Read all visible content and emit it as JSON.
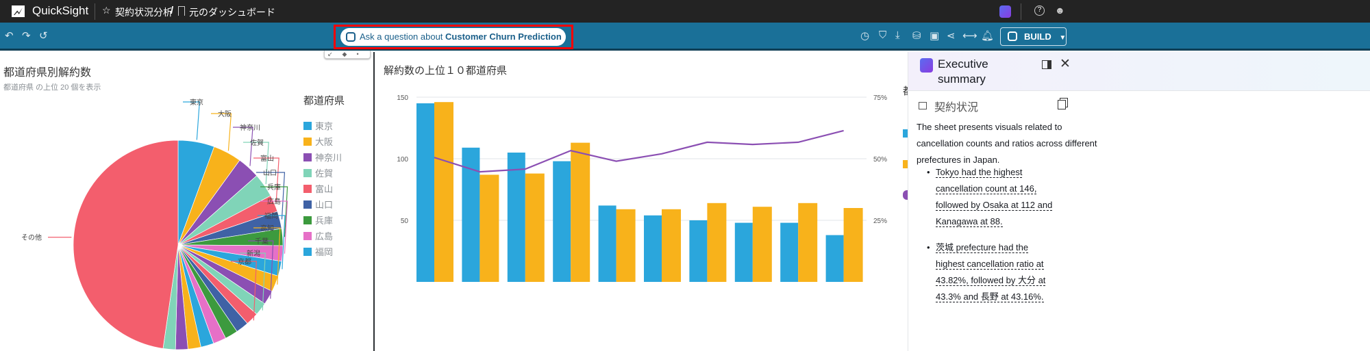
{
  "app": {
    "name": "QuickSight",
    "analysis_name": "契約状況分析",
    "separator": "/",
    "dashboard_link": "元のダッシュボード"
  },
  "toolbar": {
    "ask_prefix": "Ask a question about ",
    "ask_topic": "Customer Churn Prediction",
    "build_label": "BUILD"
  },
  "pie_visual": {
    "title": "都道府県別解約数",
    "subtitle": "都道府県 の上位 20 個を表示",
    "legend_title": "都道府県",
    "legend": [
      "東京",
      "大阪",
      "神奈川",
      "佐賀",
      "富山",
      "山口",
      "兵庫",
      "広島",
      "福岡"
    ]
  },
  "bar_visual": {
    "title": "解約数の上位１０都道府県",
    "legend_title_partial": "都"
  },
  "colors": {
    "blue": "#2ba6dc",
    "orange": "#f8b21b",
    "purple": "#8b4fb3",
    "mint": "#80d4b8",
    "red": "#f35e6d",
    "navy": "#3f62a5",
    "green": "#3c9a3e",
    "pink": "#e670c7",
    "topbar": "#232323",
    "toolbar": "#1a7098"
  },
  "chart_data": [
    {
      "type": "pie",
      "title": "都道府県別解約数",
      "subtitle": "都道府県 の上位 20 個を表示",
      "legend_title": "都道府県",
      "slices": [
        {
          "label": "東京",
          "value": 5.6
        },
        {
          "label": "大阪",
          "value": 4.4
        },
        {
          "label": "神奈川",
          "value": 3.5
        },
        {
          "label": "佐賀",
          "value": 3.7
        },
        {
          "label": "富山",
          "value": 2.6
        },
        {
          "label": "山口",
          "value": 2.7
        },
        {
          "label": "兵庫",
          "value": 2.6
        },
        {
          "label": "広島",
          "value": 2.4
        },
        {
          "label": "福岡",
          "value": 2.3
        },
        {
          "label": "高知",
          "value": 2.5
        },
        {
          "label": "千葉",
          "value": 2.2
        },
        {
          "label": "新潟",
          "value": 2.0
        },
        {
          "label": "京都",
          "value": 2.0
        },
        {
          "label": "",
          "value": 2.0
        },
        {
          "label": "",
          "value": 2.0
        },
        {
          "label": "",
          "value": 2.0
        },
        {
          "label": "",
          "value": 2.0
        },
        {
          "label": "",
          "value": 2.0
        },
        {
          "label": "",
          "value": 1.9
        },
        {
          "label": "",
          "value": 1.9
        },
        {
          "label": "その他",
          "value": 47.7
        }
      ]
    },
    {
      "type": "bar+line",
      "title": "解約数の上位１０都道府県",
      "ylim": [
        0,
        150
      ],
      "y2lim": [
        0,
        75
      ],
      "yticks": [
        "50",
        "100",
        "150"
      ],
      "y2ticks": [
        "25%",
        "50%",
        "75%"
      ],
      "grid": true,
      "series": [
        {
          "type": "bar",
          "values": [
            145,
            109,
            105,
            98,
            62,
            54,
            50,
            48,
            48,
            38
          ]
        },
        {
          "type": "bar",
          "values": [
            146,
            87,
            88,
            113,
            59,
            59,
            64,
            61,
            64,
            60
          ]
        },
        {
          "type": "line",
          "axis": "right",
          "values": [
            50.5,
            44.7,
            45.8,
            53.3,
            49,
            52,
            56.7,
            55.8,
            56.7,
            61.4
          ]
        }
      ]
    }
  ],
  "exec_summary": {
    "title_line1": "Executive",
    "title_line2": "summary",
    "section": "契約状況",
    "intro": "The sheet presents visuals related to cancellation counts and ratios across different prefectures in Japan.",
    "bullets": [
      [
        "Tokyo had the highest",
        "cancellation count at 146,",
        "followed by Osaka at 112 and",
        "Kanagawa at 88."
      ],
      [
        "茨城 prefecture had the",
        "highest cancellation ratio at",
        "43.82%, followed by 大分 at",
        "43.3% and 長野 at 43.16%."
      ]
    ]
  }
}
